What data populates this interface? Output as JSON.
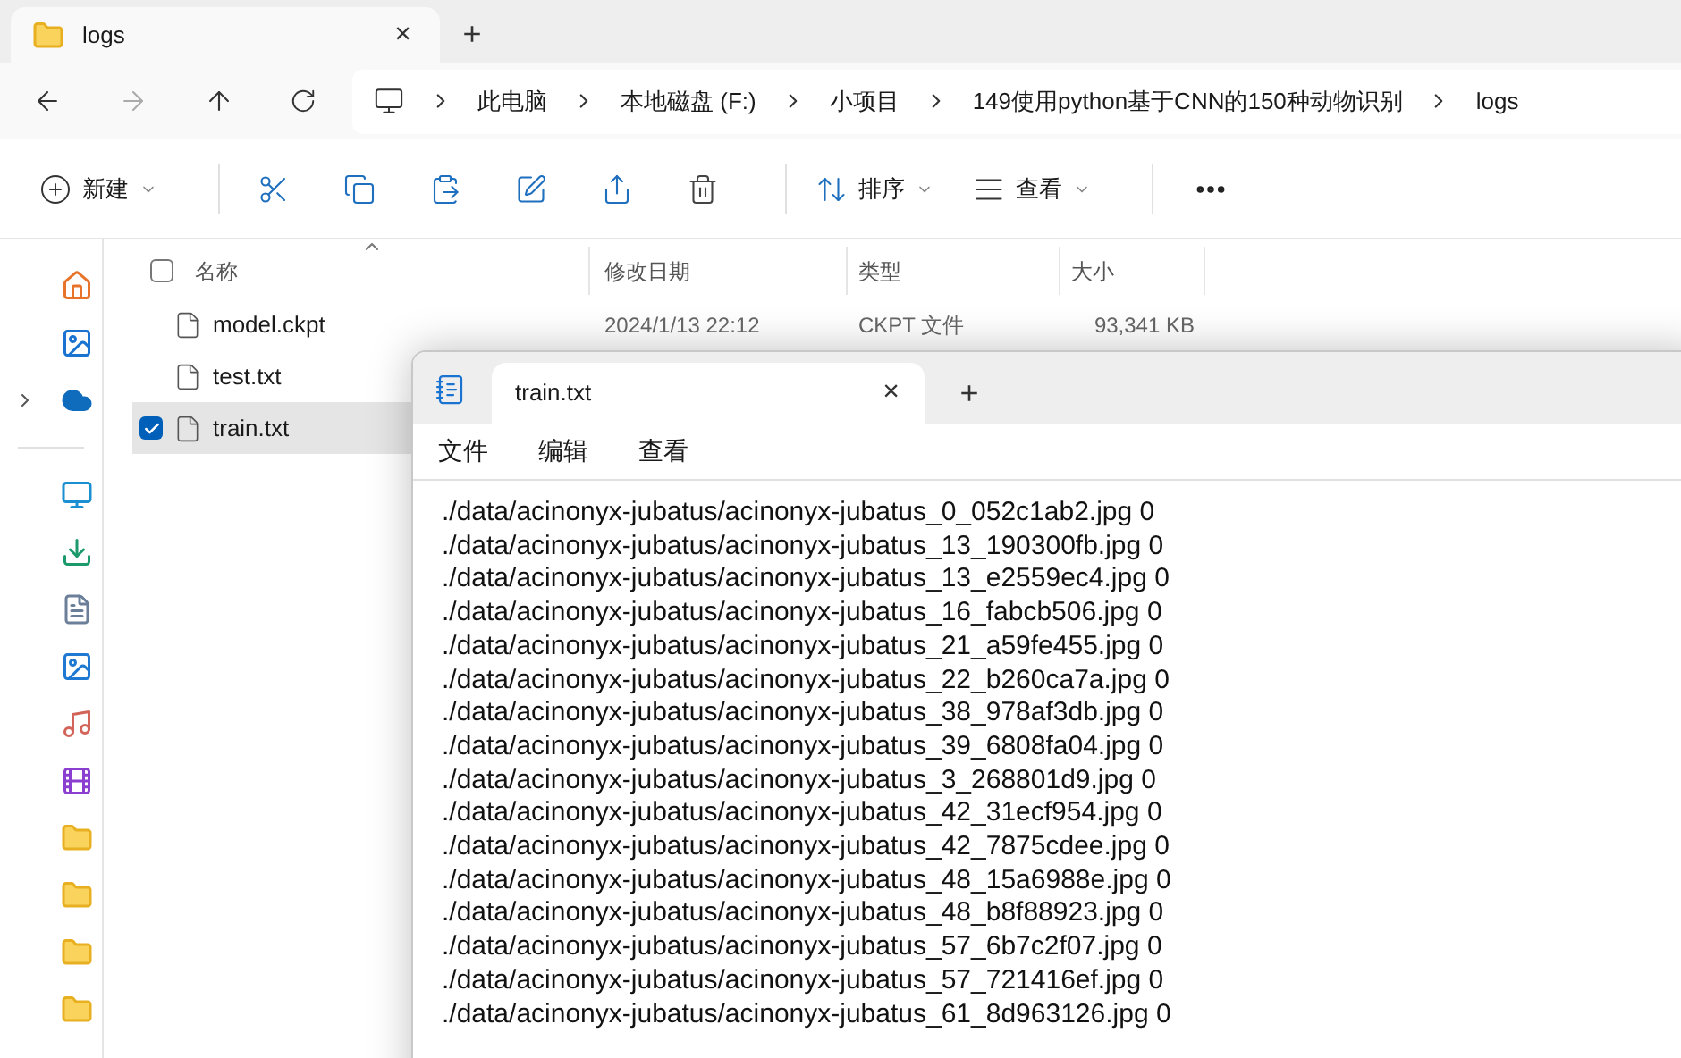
{
  "explorer": {
    "tabs": [
      {
        "label": "logs",
        "selected": true
      }
    ],
    "new_tab": "+",
    "close": "×",
    "breadcrumb": [
      "此电脑",
      "本地磁盘 (F:)",
      "小项目",
      "149使用python基于CNN的150种动物识别",
      "logs"
    ],
    "toolbar": [
      {
        "kind": "new",
        "label": "新建"
      },
      {
        "kind": "sep"
      },
      {
        "kind": "cut"
      },
      {
        "kind": "copy"
      },
      {
        "kind": "paste"
      },
      {
        "kind": "rename"
      },
      {
        "kind": "share"
      },
      {
        "kind": "delete"
      },
      {
        "kind": "sep"
      },
      {
        "kind": "sort",
        "label": "排序"
      },
      {
        "kind": "view",
        "label": "查看"
      },
      {
        "kind": "sep"
      },
      {
        "kind": "more"
      }
    ],
    "nav": [
      {
        "kind": "home",
        "expandable": false
      },
      {
        "kind": "gallery",
        "expandable": false
      },
      {
        "kind": "cloud",
        "expandable": true
      },
      {
        "kind": "sep"
      },
      {
        "kind": "desktop",
        "expandable": false
      },
      {
        "kind": "download",
        "expandable": false
      },
      {
        "kind": "document",
        "expandable": false
      },
      {
        "kind": "picture",
        "expandable": false
      },
      {
        "kind": "music",
        "expandable": false
      },
      {
        "kind": "video",
        "expandable": false
      },
      {
        "kind": "folder",
        "expandable": false
      },
      {
        "kind": "folder",
        "expandable": false
      },
      {
        "kind": "folder",
        "expandable": false
      },
      {
        "kind": "folder",
        "expandable": false
      }
    ],
    "select_all_checked": false,
    "columns": [
      "名称",
      "修改日期",
      "类型",
      "大小"
    ],
    "files": [
      {
        "name": "model.ckpt",
        "date": "2024/1/13 22:12",
        "type": "CKPT 文件",
        "size": "93,341 KB",
        "selected": false,
        "checked": false
      },
      {
        "name": "test.txt",
        "selected": false,
        "checked": false
      },
      {
        "name": "train.txt",
        "selected": true,
        "checked": true
      }
    ]
  },
  "notepad": {
    "tabs": [
      {
        "label": "train.txt",
        "selected": true
      }
    ],
    "close": "×",
    "new_tab": "+",
    "menu": [
      "文件",
      "编辑",
      "查看"
    ],
    "lines": [
      "./data/acinonyx-jubatus/acinonyx-jubatus_0_052c1ab2.jpg 0",
      "./data/acinonyx-jubatus/acinonyx-jubatus_13_190300fb.jpg 0",
      "./data/acinonyx-jubatus/acinonyx-jubatus_13_e2559ec4.jpg 0",
      "./data/acinonyx-jubatus/acinonyx-jubatus_16_fabcb506.jpg 0",
      "./data/acinonyx-jubatus/acinonyx-jubatus_21_a59fe455.jpg 0",
      "./data/acinonyx-jubatus/acinonyx-jubatus_22_b260ca7a.jpg 0",
      "./data/acinonyx-jubatus/acinonyx-jubatus_38_978af3db.jpg 0",
      "./data/acinonyx-jubatus/acinonyx-jubatus_39_6808fa04.jpg 0",
      "./data/acinonyx-jubatus/acinonyx-jubatus_3_268801d9.jpg 0",
      "./data/acinonyx-jubatus/acinonyx-jubatus_42_31ecf954.jpg 0",
      "./data/acinonyx-jubatus/acinonyx-jubatus_42_7875cdee.jpg 0",
      "./data/acinonyx-jubatus/acinonyx-jubatus_48_15a6988e.jpg 0",
      "./data/acinonyx-jubatus/acinonyx-jubatus_48_b8f88923.jpg 0",
      "./data/acinonyx-jubatus/acinonyx-jubatus_57_6b7c2f07.jpg 0",
      "./data/acinonyx-jubatus/acinonyx-jubatus_57_721416ef.jpg 0",
      "./data/acinonyx-jubatus/acinonyx-jubatus_61_8d963126.jpg 0"
    ]
  }
}
